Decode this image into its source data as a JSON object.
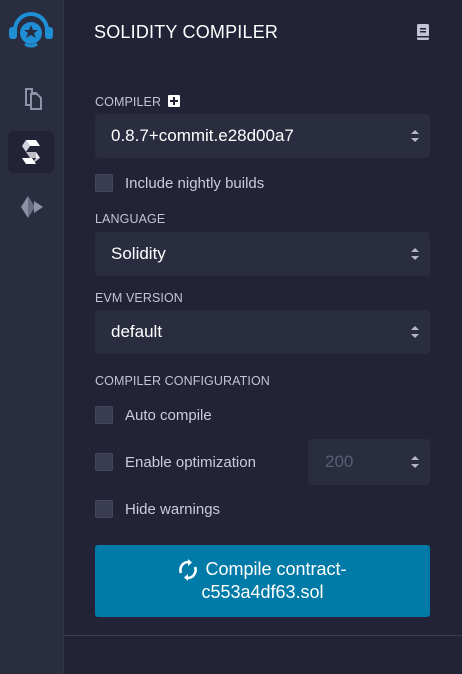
{
  "panel": {
    "title": "SOLIDITY COMPILER"
  },
  "compiler": {
    "label": "COMPILER",
    "version": "0.8.7+commit.e28d00a7",
    "nightly_label": "Include nightly builds",
    "nightly_checked": false
  },
  "language": {
    "label": "LANGUAGE",
    "value": "Solidity"
  },
  "evm": {
    "label": "EVM VERSION",
    "value": "default"
  },
  "config": {
    "label": "COMPILER CONFIGURATION",
    "auto_compile_label": "Auto compile",
    "optimization_label": "Enable optimization",
    "optimization_runs": "200",
    "hide_warnings_label": "Hide warnings"
  },
  "compile_button": {
    "line1": "Compile contract-",
    "line2": "c553a4df63.sol"
  },
  "sidebar": {
    "items": [
      "file-explorer-icon",
      "solidity-compiler-icon",
      "deploy-run-icon"
    ]
  },
  "colors": {
    "accent": "#007aa6",
    "background": "#222336",
    "logo": "#1e8fd4"
  }
}
